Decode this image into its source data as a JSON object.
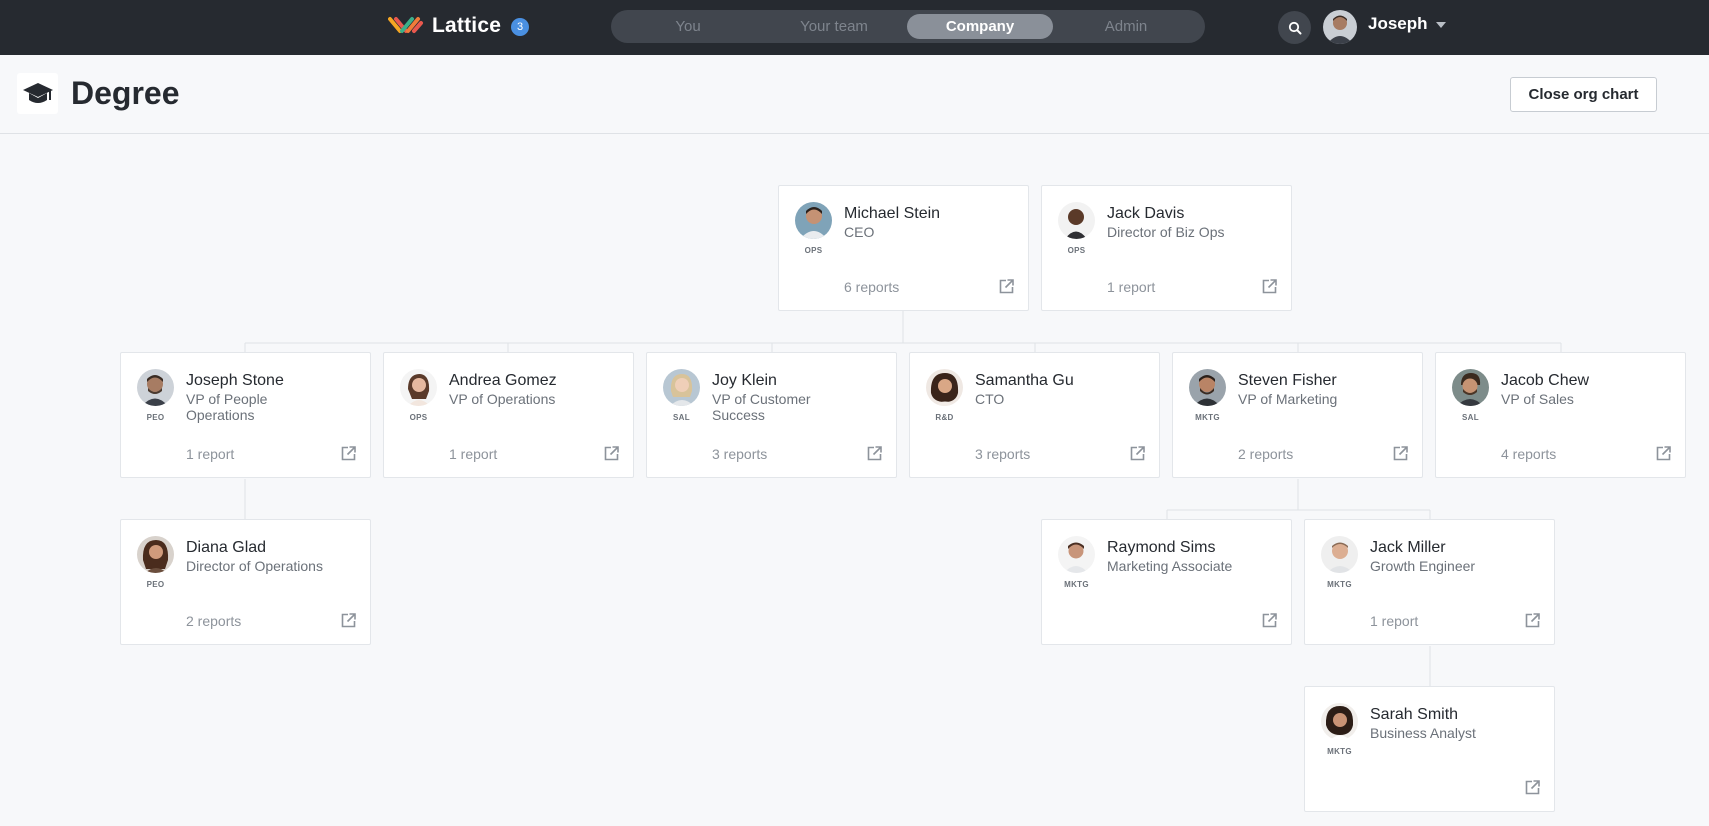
{
  "app": {
    "name": "Lattice",
    "notification_count": "3"
  },
  "nav": {
    "tabs": [
      {
        "label": "You"
      },
      {
        "label": "Your team"
      },
      {
        "label": "Company"
      },
      {
        "label": "Admin"
      }
    ],
    "active_tab": "Company"
  },
  "user": {
    "name": "Joseph"
  },
  "page": {
    "company_name": "Degree",
    "close_button": "Close org chart"
  },
  "colors": {
    "topbar": "#262a30",
    "accent_badge": "#4a90e2",
    "background": "#f7f8fa"
  },
  "org": [
    {
      "name": "Michael Stein",
      "title": "CEO",
      "dept": "OPS",
      "reports": "6 reports"
    },
    {
      "name": "Jack Davis",
      "title": "Director of Biz Ops",
      "dept": "OPS",
      "reports": "1 report"
    },
    {
      "name": "Joseph Stone",
      "title": "VP of People Operations",
      "dept": "PEO",
      "reports": "1 report"
    },
    {
      "name": "Andrea Gomez",
      "title": "VP of Operations",
      "dept": "OPS",
      "reports": "1 report"
    },
    {
      "name": "Joy Klein",
      "title": "VP of Customer Success",
      "dept": "SAL",
      "reports": "3 reports"
    },
    {
      "name": "Samantha Gu",
      "title": "CTO",
      "dept": "R&D",
      "reports": "3 reports"
    },
    {
      "name": "Steven Fisher",
      "title": "VP of Marketing",
      "dept": "MKTG",
      "reports": "2 reports"
    },
    {
      "name": "Jacob Chew",
      "title": "VP of Sales",
      "dept": "SAL",
      "reports": "4 reports"
    },
    {
      "name": "Diana Glad",
      "title": "Director of Operations",
      "dept": "PEO",
      "reports": "2 reports"
    },
    {
      "name": "Raymond Sims",
      "title": "Marketing Associate",
      "dept": "MKTG",
      "reports": ""
    },
    {
      "name": "Jack Miller",
      "title": "Growth Engineer",
      "dept": "MKTG",
      "reports": "1 report"
    },
    {
      "name": "Sarah Smith",
      "title": "Business Analyst",
      "dept": "MKTG",
      "reports": ""
    }
  ]
}
